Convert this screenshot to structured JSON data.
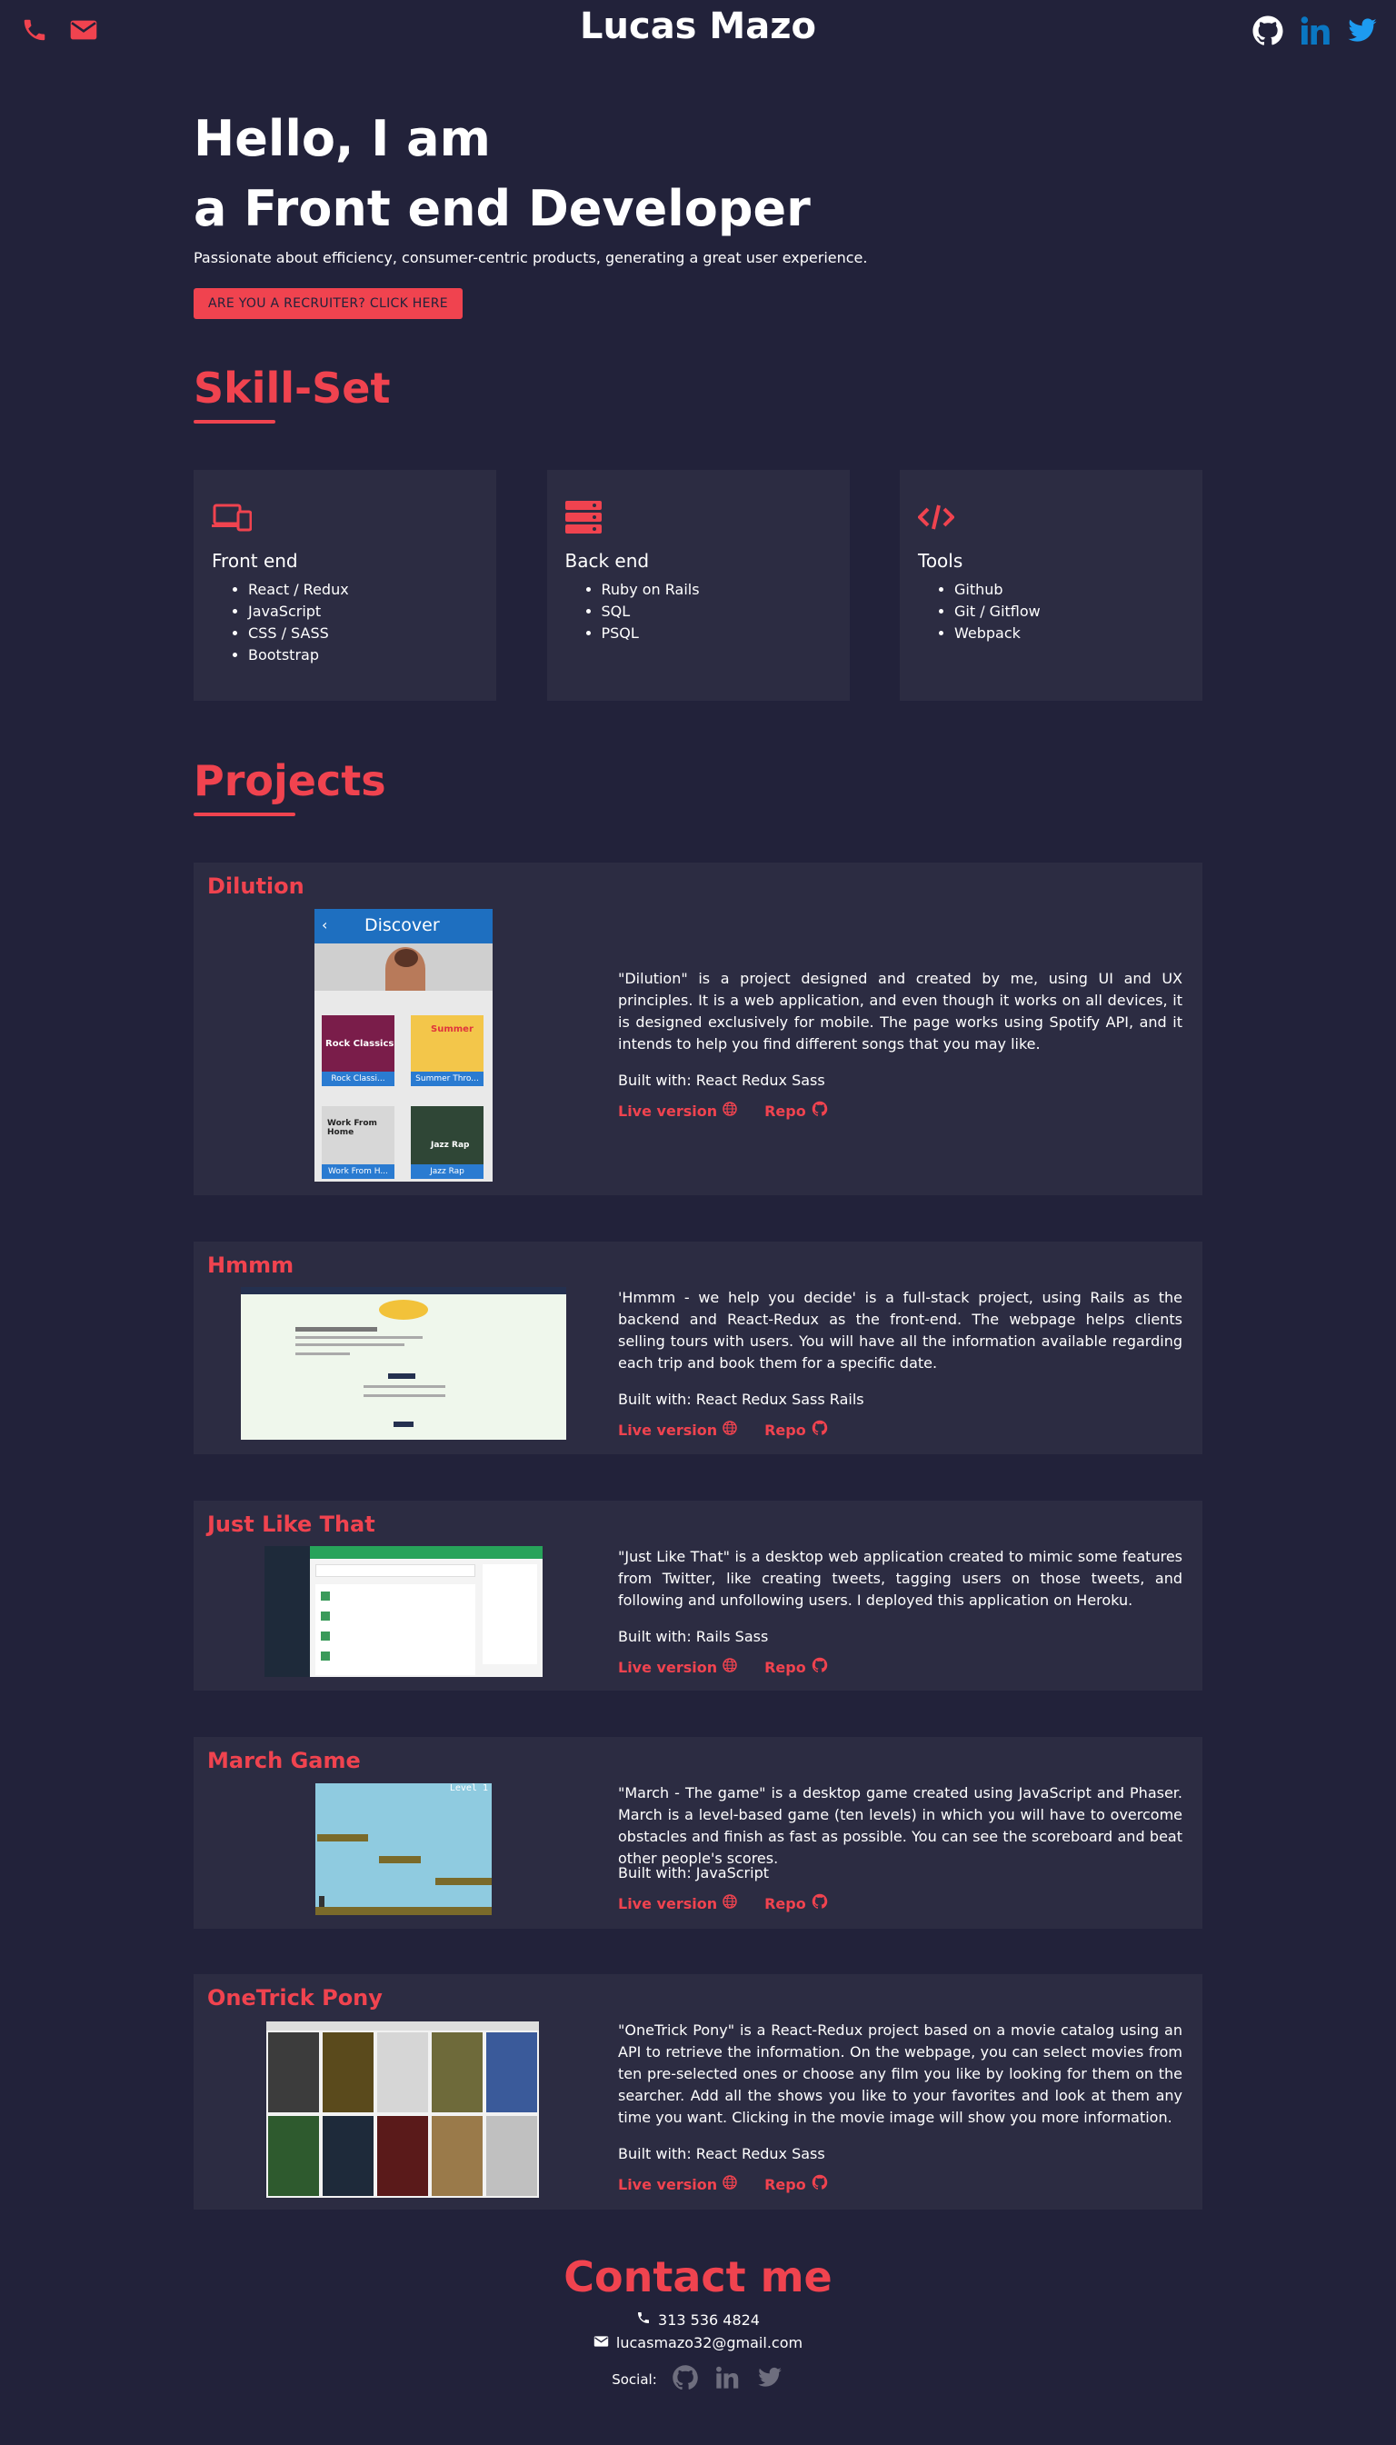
{
  "header": {
    "brand": "Lucas Mazo"
  },
  "hero": {
    "line1": "Hello, I am",
    "line2": "a Front end Developer",
    "tagline": "Passionate about efficiency, consumer-centric products, generating a great user experience.",
    "cta": "ARE YOU A RECRUITER? CLICK HERE"
  },
  "skills": {
    "title": "Skill-Set",
    "cards": [
      {
        "title": "Front end",
        "items": [
          "React / Redux",
          "JavaScript",
          "CSS / SASS",
          "Bootstrap"
        ],
        "icon": "devices-icon"
      },
      {
        "title": "Back end",
        "items": [
          "Ruby on Rails",
          "SQL",
          "PSQL"
        ],
        "icon": "server-icon"
      },
      {
        "title": "Tools",
        "items": [
          "Github",
          "Git / Gitflow",
          "Webpack"
        ],
        "icon": "code-icon"
      }
    ]
  },
  "projects_title": "Projects",
  "projects": [
    {
      "name": "Dilution",
      "description": "\"Dilution\" is a project designed and created by me, using UI and UX principles. It is a web application, and even though it works on all devices, it is designed exclusively for mobile. The page works using Spotify API, and it intends to help you find different songs that you may like.",
      "built": "Built with:  React Redux Sass",
      "live": "Live version",
      "repo": "Repo",
      "screenshot": {
        "header": "Discover",
        "tiles": [
          "Rock Classi...",
          "Summer Thro...",
          "Work From H...",
          "Jazz Rap"
        ],
        "tile_titles": [
          "Rock Classics",
          "Summer",
          "Work From Home",
          "Jazz Rap"
        ]
      }
    },
    {
      "name": "Hmmm",
      "description": "'Hmmm - we help you decide' is a full-stack project, using Rails as the backend and React-Redux as the front-end. The webpage helps clients selling tours with users. You will have all the information available regarding each trip and book them for a specific date.",
      "built": "Built with:  React Redux Sass Rails",
      "live": "Live version",
      "repo": "Repo"
    },
    {
      "name": "Just Like That",
      "description": "\"Just Like That\" is a desktop web application created to mimic some features from Twitter, like creating tweets, tagging users on those tweets, and following and unfollowing users. I deployed this application on Heroku.",
      "built": "Built with:  Rails Sass",
      "live": "Live version",
      "repo": "Repo"
    },
    {
      "name": "March Game",
      "description": "\"March - The game\" is a desktop game created using JavaScript and Phaser. March is a level-based game (ten levels) in which you will have to overcome obstacles and finish as fast as possible. You can see the scoreboard and beat other people's scores.",
      "built": "Built with:  JavaScript",
      "live": "Live version",
      "repo": "Repo",
      "screenshot": {
        "level": "Level 1"
      }
    },
    {
      "name": "OneTrick Pony",
      "description": "\"OneTrick Pony\" is a React-Redux project based on a movie catalog using an API to retrieve the information. On the webpage, you can select movies from ten pre-selected ones or choose any film you like by looking for them on the searcher. Add all the shows you like to your favorites and look at them any time you want. Clicking in the movie image will show you more information.",
      "built": "Built with:  React Redux Sass",
      "live": "Live version",
      "repo": "Repo"
    }
  ],
  "contact": {
    "title": "Contact me",
    "phone": "313 536 4824",
    "email": "lucasmazo32@gmail.com",
    "social_label": "Social:"
  },
  "colors": {
    "background": "#22223a",
    "card": "#2c2c42",
    "accent": "#f0434f",
    "linkedin": "#0a77c2",
    "twitter": "#1d9bf0"
  }
}
